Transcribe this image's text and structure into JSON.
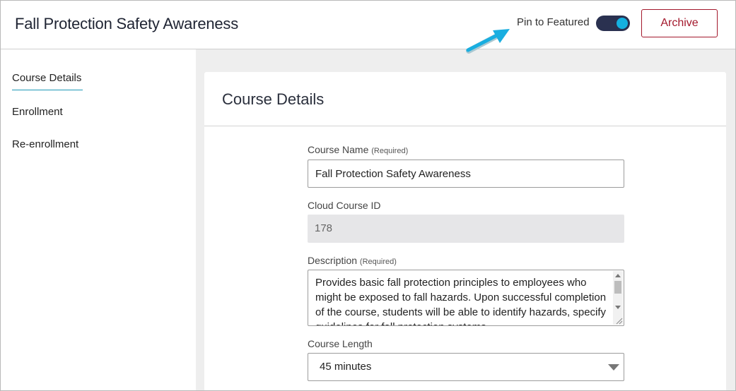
{
  "header": {
    "title": "Fall Protection Safety Awareness",
    "pin_label": "Pin to Featured",
    "pin_enabled": true,
    "archive_label": "Archive"
  },
  "sidebar": {
    "items": [
      {
        "label": "Course Details",
        "active": true
      },
      {
        "label": "Enrollment",
        "active": false
      },
      {
        "label": "Re-enrollment",
        "active": false
      }
    ]
  },
  "card": {
    "title": "Course Details",
    "course_name": {
      "label": "Course Name",
      "required_note": "(Required)",
      "value": "Fall Protection Safety Awareness"
    },
    "cloud_course_id": {
      "label": "Cloud Course ID",
      "value": "178"
    },
    "description": {
      "label": "Description",
      "required_note": "(Required)",
      "value": "Provides basic fall protection principles to employees who might be exposed to fall hazards. Upon successful completion of the course, students will be able to identify hazards, specify guidelines for fall protection systems"
    },
    "course_length": {
      "label": "Course Length",
      "value": "45 minutes"
    }
  },
  "colors": {
    "accent": "#1d98b6",
    "archive": "#a3182c",
    "toggle_track": "#2a3150",
    "toggle_knob": "#14b0e0",
    "annotation_arrow": "#19aee0"
  }
}
